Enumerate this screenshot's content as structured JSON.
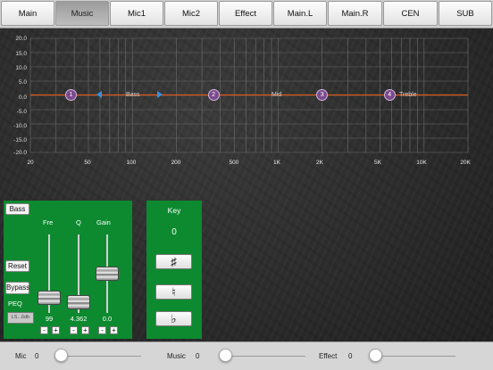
{
  "tabs": [
    {
      "label": "Main",
      "active": false
    },
    {
      "label": "Music",
      "active": true
    },
    {
      "label": "Mic1",
      "active": false
    },
    {
      "label": "Mic2",
      "active": false
    },
    {
      "label": "Effect",
      "active": false
    },
    {
      "label": "Main.L",
      "active": false
    },
    {
      "label": "Main.R",
      "active": false
    },
    {
      "label": "CEN",
      "active": false
    },
    {
      "label": "SUB",
      "active": false
    }
  ],
  "graph": {
    "y_labels": [
      "20.0",
      "15.0",
      "10.0",
      "5.0",
      "0.0",
      "-5.0",
      "-10.0",
      "-15.0",
      "-20.0"
    ],
    "x_labels": [
      "20",
      "50",
      "100",
      "200",
      "500",
      "1K",
      "2K",
      "5K",
      "10K",
      "20K"
    ],
    "bands": {
      "low": "Bass",
      "mid": "Mid",
      "high": "Treble"
    },
    "nodes": [
      {
        "label": "1",
        "freq": 38
      },
      {
        "label": "2",
        "freq": 360
      },
      {
        "label": "3",
        "freq": 2000
      },
      {
        "label": "4",
        "freq": 5800
      }
    ],
    "colors": {
      "curve": "#d85a1e",
      "grid": "#6d6d6d",
      "node": "#7b4a8d",
      "arrow": "#3b8fe0"
    }
  },
  "peq": {
    "band_button": "Bass",
    "reset_button": "Reset",
    "bypass_button": "Bypass",
    "section_label": "PEQ",
    "preset": "LS...6db",
    "sliders": [
      {
        "name": "Fre",
        "value": "99",
        "level": 0.12
      },
      {
        "name": "Q",
        "value": "4.362",
        "level": 0.05
      },
      {
        "name": "Gain",
        "value": "0.0",
        "level": 0.5
      }
    ],
    "minus": "-",
    "plus": "+"
  },
  "key": {
    "title": "Key",
    "value": "0",
    "sharp": "♯",
    "natural": "♮",
    "flat": "♭"
  },
  "mixer": [
    {
      "label": "Mic",
      "value": "0",
      "level": 0
    },
    {
      "label": "Music",
      "value": "0",
      "level": 0
    },
    {
      "label": "Effect",
      "value": "0",
      "level": 0
    }
  ],
  "accent": "#0d8a2f"
}
